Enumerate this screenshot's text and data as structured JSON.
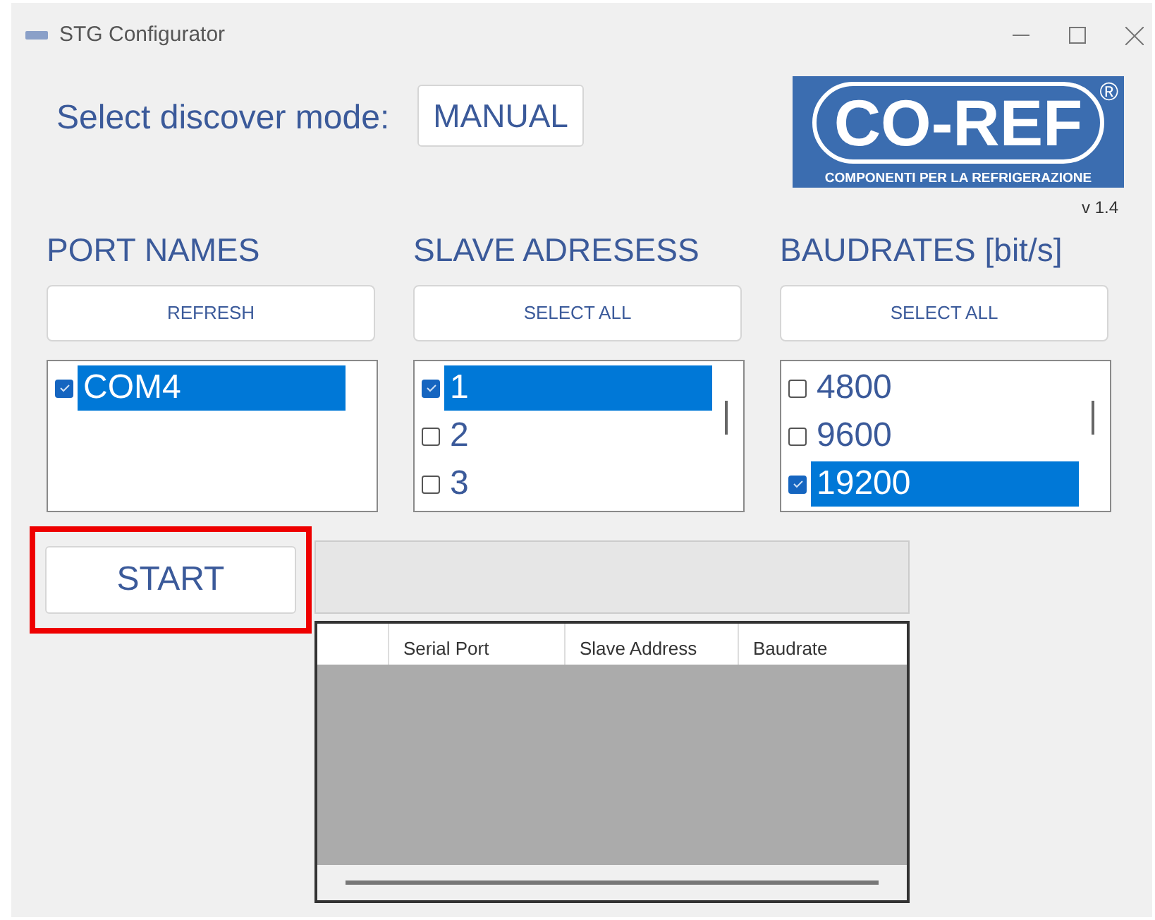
{
  "window": {
    "title": "STG Configurator"
  },
  "discover": {
    "label": "Select discover mode:",
    "value": "MANUAL"
  },
  "logo": {
    "name": "CO-REF",
    "mark": "®",
    "tagline": "COMPONENTI PER LA REFRIGERAZIONE"
  },
  "version": "v 1.4",
  "lists": [
    {
      "title": "PORT NAMES",
      "button": "REFRESH",
      "scrollbar": false,
      "items": [
        {
          "text": "COM4",
          "checked": true,
          "selected": true
        }
      ]
    },
    {
      "title": "SLAVE ADRESESS",
      "button": "SELECT ALL",
      "scrollbar": true,
      "items": [
        {
          "text": "1",
          "checked": true,
          "selected": true
        },
        {
          "text": "2",
          "checked": false,
          "selected": false
        },
        {
          "text": "3",
          "checked": false,
          "selected": false
        }
      ]
    },
    {
      "title": "BAUDRATES [bit/s]",
      "button": "SELECT ALL",
      "scrollbar": true,
      "items": [
        {
          "text": "4800",
          "checked": false,
          "selected": false
        },
        {
          "text": "9600",
          "checked": false,
          "selected": false
        },
        {
          "text": "19200",
          "checked": true,
          "selected": true
        }
      ]
    }
  ],
  "start": {
    "label": "START",
    "highlighted": true
  },
  "progress": {
    "level": 0
  },
  "table": {
    "columns": [
      "Serial Port",
      "Slave Address",
      "Baudrate"
    ]
  }
}
